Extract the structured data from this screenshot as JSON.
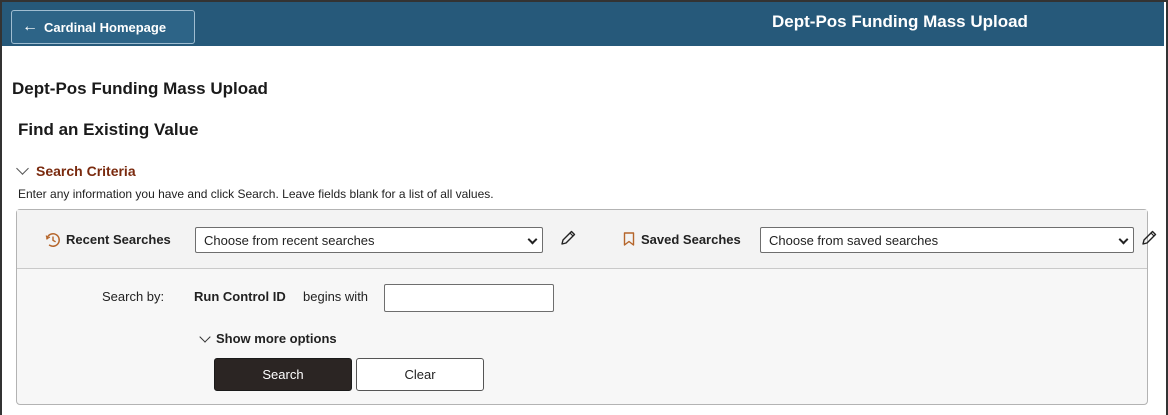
{
  "header": {
    "home_button_label": "Cardinal Homepage",
    "title": "Dept-Pos Funding Mass Upload"
  },
  "page": {
    "title": "Dept-Pos Funding Mass Upload",
    "section_title": "Find an Existing Value"
  },
  "criteria": {
    "toggle_label": "Search Criteria",
    "instructions": "Enter any information you have and click Search. Leave fields blank for a list of all values."
  },
  "recent": {
    "label": "Recent Searches",
    "placeholder": "Choose from recent searches"
  },
  "saved": {
    "label": "Saved Searches",
    "placeholder": "Choose from saved searches"
  },
  "search_by": {
    "label": "Search by:",
    "field": "Run Control ID",
    "operator": "begins with",
    "value": ""
  },
  "more_options_label": "Show more options",
  "buttons": {
    "search": "Search",
    "clear": "Clear"
  },
  "colors": {
    "header_bg": "#26597a",
    "criteria_accent": "#7a2a0e",
    "search_button_bg": "#2b2523",
    "bookmark_icon": "#b5652a"
  }
}
